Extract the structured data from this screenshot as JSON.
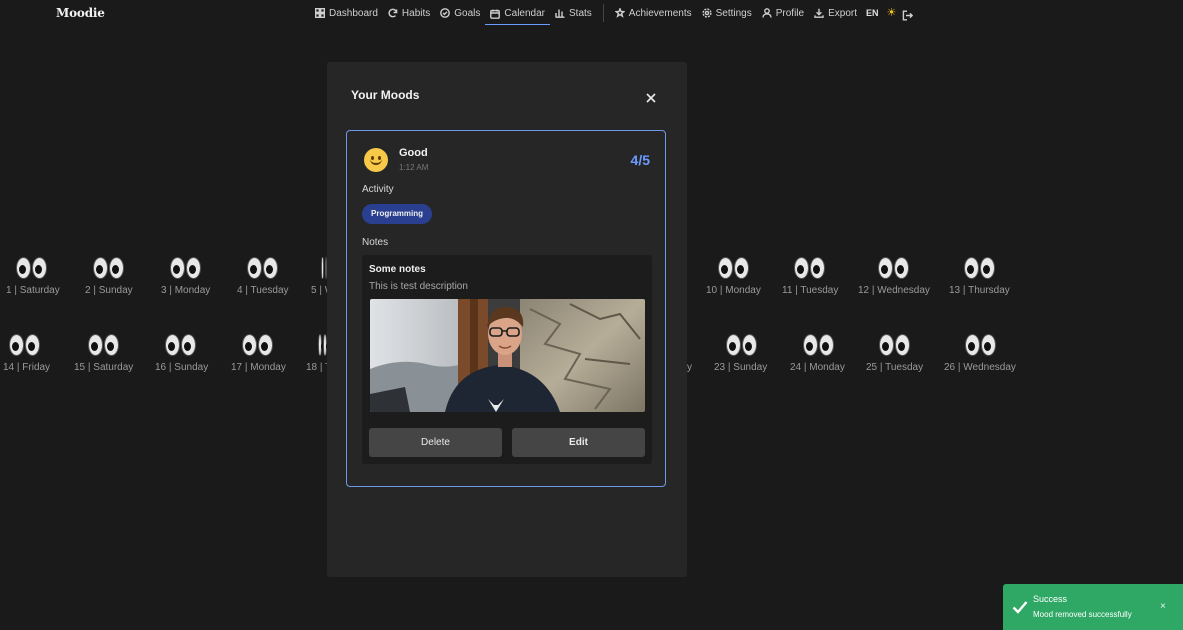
{
  "app": {
    "brand": "Moodie"
  },
  "nav": {
    "items": [
      {
        "label": "Dashboard",
        "icon": "dashboard-icon"
      },
      {
        "label": "Habits",
        "icon": "habits-icon"
      },
      {
        "label": "Goals",
        "icon": "goals-icon"
      },
      {
        "label": "Calendar",
        "icon": "calendar-icon",
        "active": true
      },
      {
        "label": "Stats",
        "icon": "stats-icon"
      }
    ],
    "items_right": [
      {
        "label": "Achievements",
        "icon": "achievements-icon"
      },
      {
        "label": "Settings",
        "icon": "gear-icon"
      },
      {
        "label": "Profile",
        "icon": "user-icon"
      },
      {
        "label": "Export",
        "icon": "download-icon"
      }
    ],
    "language": "EN",
    "theme_icon": "sun-icon",
    "logout_icon": "logout-icon",
    "accent_color": "#6b9cff"
  },
  "calendar": {
    "row1": [
      {
        "label": "1 | Saturday"
      },
      {
        "label": "2 | Sunday"
      },
      {
        "label": "3 | Monday"
      },
      {
        "label": "4 | Tuesday"
      },
      {
        "label": "5 | W"
      },
      {
        "label": "10 | Monday"
      },
      {
        "label": "11 | Tuesday"
      },
      {
        "label": "12 | Wednesday"
      },
      {
        "label": "13 | Thursday"
      }
    ],
    "row2": [
      {
        "label": "14 | Friday"
      },
      {
        "label": "15 | Saturday"
      },
      {
        "label": "16 | Sunday"
      },
      {
        "label": "17 | Monday"
      },
      {
        "label": "18 | T"
      },
      {
        "label": "y"
      },
      {
        "label": "23 | Sunday"
      },
      {
        "label": "24 | Monday"
      },
      {
        "label": "25 | Tuesday"
      },
      {
        "label": "26 | Wednesday"
      }
    ]
  },
  "modal": {
    "title": "Your Moods",
    "mood": {
      "name": "Good",
      "time": "1:12 AM",
      "score": "4/5",
      "emoji": "slightly-smiling-face"
    },
    "activity_label": "Activity",
    "activities": [
      "Programming"
    ],
    "notes_label": "Notes",
    "note": {
      "title": "Some notes",
      "description": "This is test description"
    },
    "delete_label": "Delete",
    "edit_label": "Edit"
  },
  "toast": {
    "title": "Success",
    "message": "Mood removed successfully",
    "close": "×",
    "color": "#2fa865"
  }
}
